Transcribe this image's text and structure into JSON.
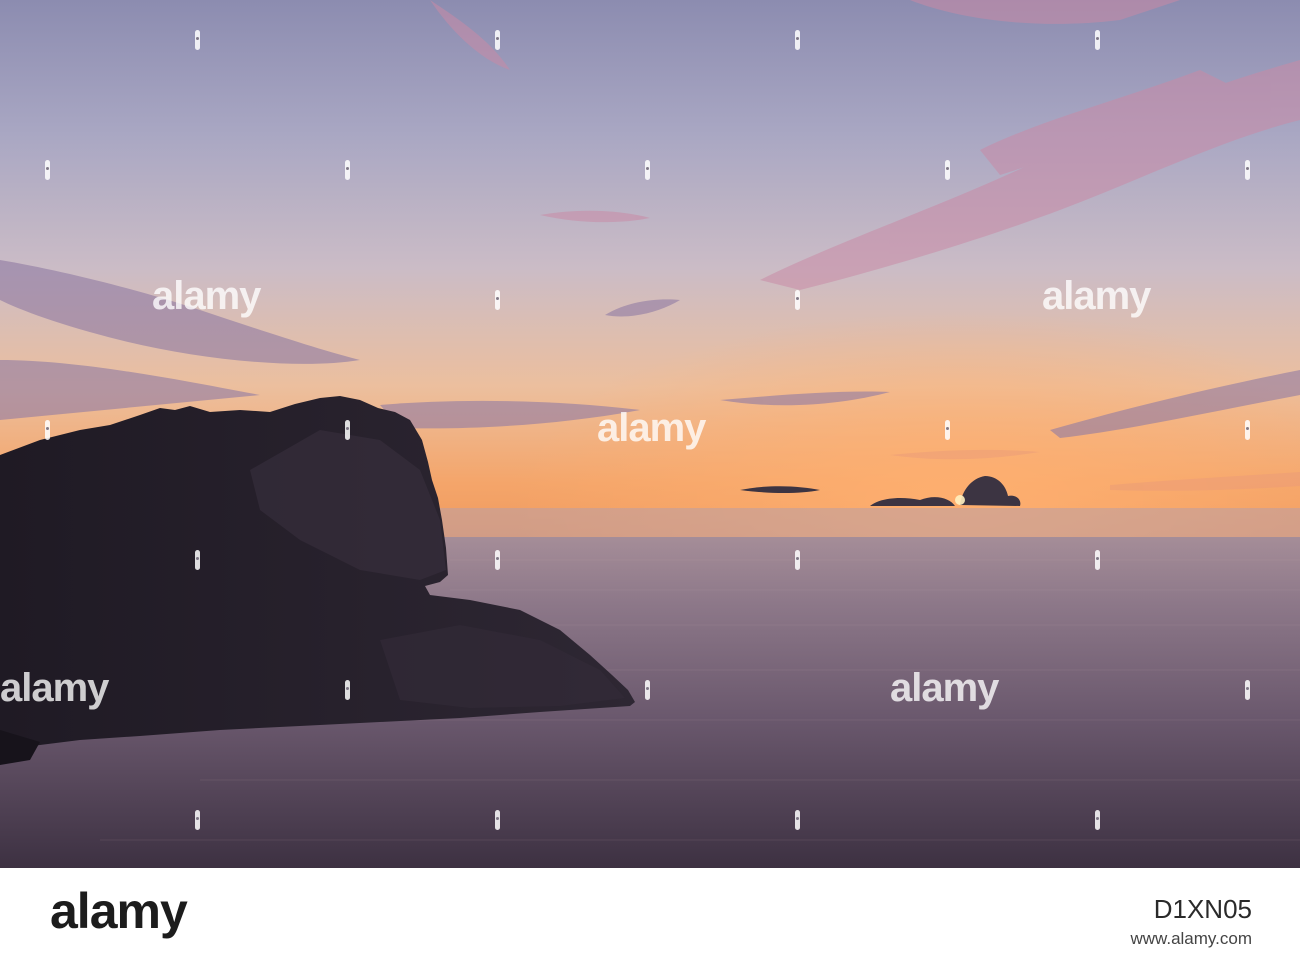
{
  "image": {
    "subject": "sunset-over-sea-with-headland-silhouette",
    "colors": {
      "sky_top": "#8e8fb2",
      "sky_mid": "#c6b9c4",
      "sky_low": "#f0b98f",
      "horizon_glow": "#f49a55",
      "sea_far": "#a18a96",
      "sea_near": "#3f3244",
      "cliff": "#231e2a"
    }
  },
  "watermark": {
    "brand_text": "alamy"
  },
  "footer": {
    "logo_text": "alamy",
    "image_id": "D1XN05",
    "site_url": "www.alamy.com"
  }
}
